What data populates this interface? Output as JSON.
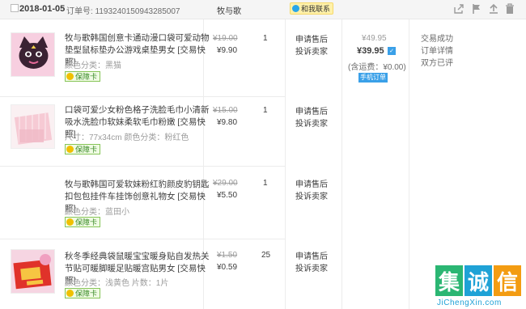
{
  "order": {
    "date": "2018-01-05",
    "number_label": "订单号: 1193240150943285007",
    "shop": "牧与歌",
    "contact_label": "和我联系"
  },
  "header_icons": [
    "share-icon",
    "flag-icon",
    "upload-icon",
    "delete-icon"
  ],
  "items": [
    {
      "title": "牧与歌韩国创意卡通动漫口袋可爱动物垫型鼠标垫办公游戏桌垫男女 [交易快照]",
      "attrs": "颜色分类：黑猫",
      "badge": "保障卡",
      "orig_price": "¥19.00",
      "price": "¥9.90",
      "qty": "1",
      "service": "申请售后\n投诉卖家"
    },
    {
      "title": "口袋可爱少女粉色格子洗脸毛巾小清新吸水洗脸巾软妹柔软毛巾粉嫩 [交易快照]",
      "attrs": "尺寸：77x34cm  颜色分类：粉红色",
      "badge": "保障卡",
      "orig_price": "¥15.00",
      "price": "¥9.80",
      "qty": "1",
      "service": "申请售后\n投诉卖家"
    },
    {
      "title": "牧与歌韩国可爱软妹粉红豹颜皮豹钥匙扣包包挂件车挂饰创意礼物女 [交易快照]",
      "attrs": "颜色分类：蓝田小",
      "badge": "保障卡",
      "orig_price": "¥29.00",
      "price": "¥5.50",
      "qty": "1",
      "service": "申请售后\n投诉卖家"
    },
    {
      "title": "秋冬季经典袋鼠暖宝宝暖身贴自发热关节贴可暖脚暖足贴暖宫贴男女 [交易快照]",
      "attrs": "颜色分类：浅黄色  片数：1片",
      "badge": "保障卡",
      "orig_price": "¥1.50",
      "price": "¥0.59",
      "qty": "25",
      "service": "申请售后\n投诉卖家"
    }
  ],
  "summary": {
    "orig_total": "¥49.95",
    "total": "¥39.95",
    "shipping": "(含运费：¥0.00)",
    "mobile_order": "手机订单",
    "status": "交易成功\n订单详情\n双方已评"
  },
  "watermark": {
    "chars": [
      "集",
      "诚",
      "信"
    ],
    "url": "JiChengXin.com",
    "colors": [
      "#2bb673",
      "#1fa2d6",
      "#f39c12"
    ]
  }
}
